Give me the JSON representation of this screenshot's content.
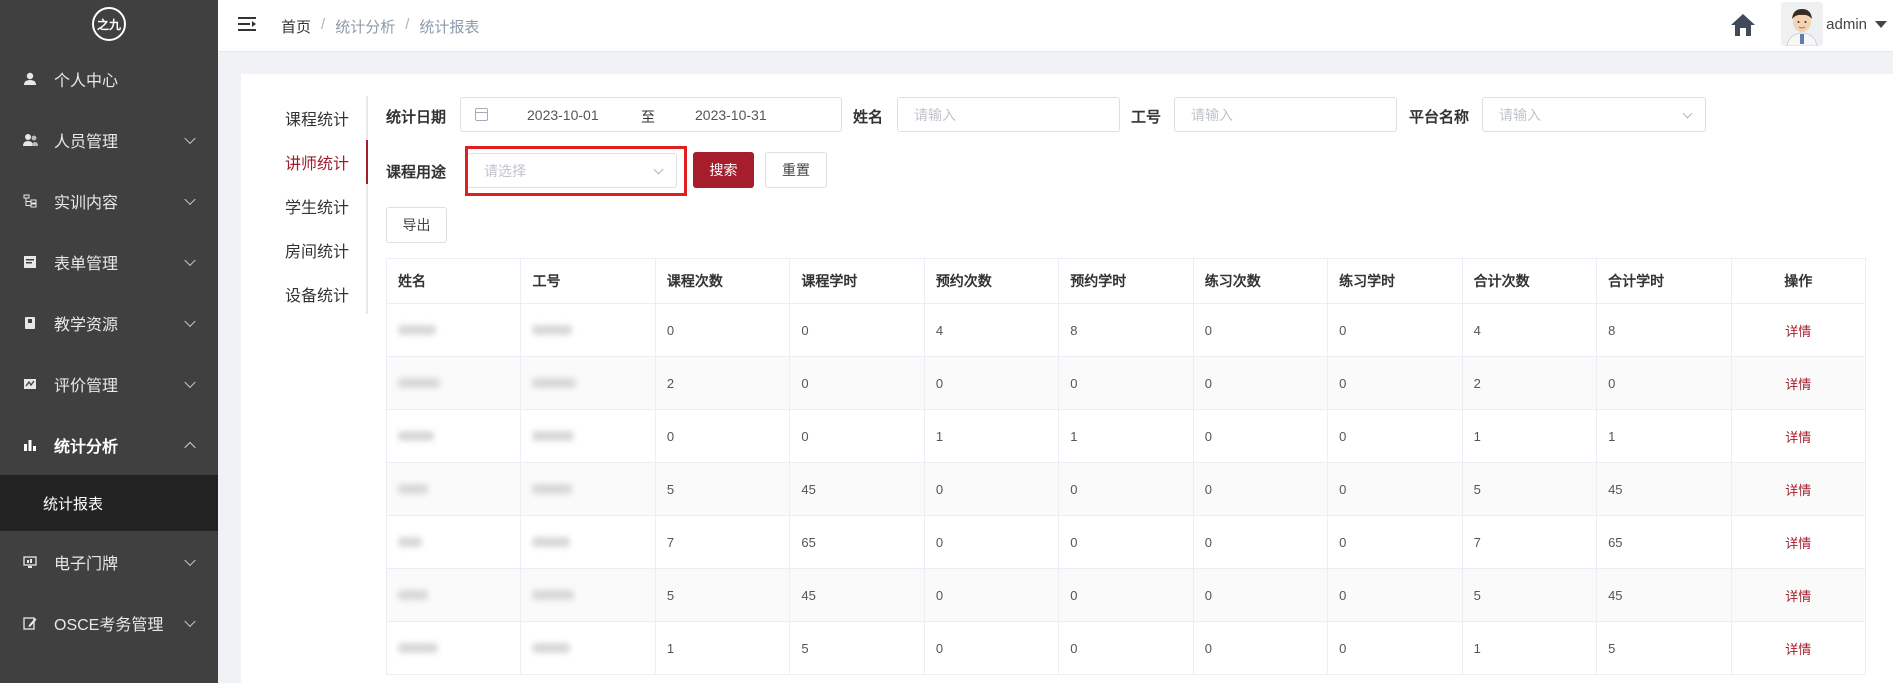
{
  "sidebar": {
    "logo_text": "之九",
    "items": [
      {
        "label": "个人中心",
        "icon": "user-icon",
        "has_arrow": false
      },
      {
        "label": "人员管理",
        "icon": "people-icon",
        "has_arrow": true
      },
      {
        "label": "实训内容",
        "icon": "tree-icon",
        "has_arrow": true
      },
      {
        "label": "表单管理",
        "icon": "form-icon",
        "has_arrow": true
      },
      {
        "label": "教学资源",
        "icon": "book-icon",
        "has_arrow": true
      },
      {
        "label": "评价管理",
        "icon": "evaluation-icon",
        "has_arrow": true
      },
      {
        "label": "统计分析",
        "icon": "bar-chart-icon",
        "has_arrow": true,
        "expanded": true
      }
    ],
    "submenu_active": "统计报表",
    "items_after": [
      {
        "label": "电子门牌",
        "icon": "monitor-icon",
        "has_arrow": true
      },
      {
        "label": "OSCE考务管理",
        "icon": "edit-icon",
        "has_arrow": true
      }
    ]
  },
  "header": {
    "breadcrumb": [
      "首页",
      "统计分析",
      "统计报表"
    ],
    "user_name": "admin"
  },
  "left_nav": {
    "items": [
      "课程统计",
      "讲师统计",
      "学生统计",
      "房间统计",
      "设备统计"
    ],
    "active_index": 1
  },
  "filters": {
    "date_label": "统计日期",
    "date_start": "2023-10-01",
    "date_to": "至",
    "date_end": "2023-10-31",
    "name_label": "姓名",
    "name_placeholder": "请输入",
    "id_label": "工号",
    "id_placeholder": "请输入",
    "platform_label": "平台名称",
    "platform_placeholder": "请输入",
    "purpose_label": "课程用途",
    "purpose_placeholder": "请选择",
    "search_label": "搜索",
    "reset_label": "重置",
    "export_label": "导出"
  },
  "table": {
    "columns": [
      "姓名",
      "工号",
      "课程次数",
      "课程学时",
      "预约次数",
      "预约学时",
      "练习次数",
      "练习学时",
      "合计次数",
      "合计学时",
      "操作"
    ],
    "rows": [
      {
        "values": [
          "0",
          "0",
          "4",
          "8",
          "0",
          "0",
          "4",
          "8"
        ],
        "action": "详情"
      },
      {
        "values": [
          "2",
          "0",
          "0",
          "0",
          "0",
          "0",
          "2",
          "0"
        ],
        "action": "详情"
      },
      {
        "values": [
          "0",
          "0",
          "1",
          "1",
          "0",
          "0",
          "1",
          "1"
        ],
        "action": "详情"
      },
      {
        "values": [
          "5",
          "45",
          "0",
          "0",
          "0",
          "0",
          "5",
          "45"
        ],
        "action": "详情"
      },
      {
        "values": [
          "7",
          "65",
          "0",
          "0",
          "0",
          "0",
          "7",
          "65"
        ],
        "action": "详情"
      },
      {
        "values": [
          "5",
          "45",
          "0",
          "0",
          "0",
          "0",
          "5",
          "45"
        ],
        "action": "详情"
      },
      {
        "values": [
          "1",
          "5",
          "0",
          "0",
          "0",
          "0",
          "1",
          "5"
        ],
        "action": "详情"
      }
    ]
  },
  "colors": {
    "accent": "#a61d2c",
    "sidebar_bg": "#404040",
    "highlight_box": "#e02020"
  }
}
